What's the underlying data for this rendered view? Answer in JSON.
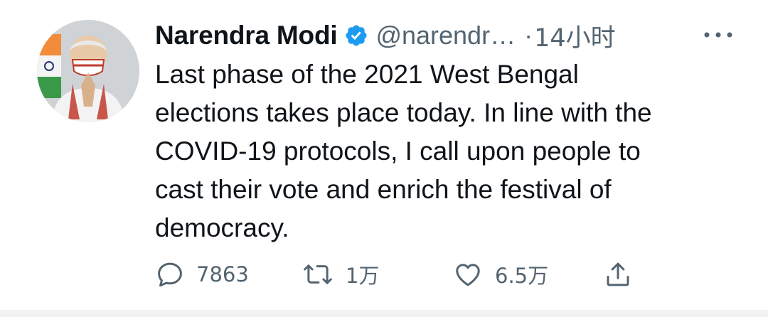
{
  "tweet": {
    "author": {
      "display_name": "Narendra Modi",
      "handle": "@narendr…",
      "avatar_icon": "avatar-photo",
      "verified_icon": "verified-badge-icon"
    },
    "separator": "·",
    "time": "14小时",
    "more_icon": "more-icon",
    "text_lines": [
      "Last phase of the 2021 West Bengal",
      "elections takes place today. In line with the",
      "COVID-19 protocols, I call upon people to",
      "cast their vote and enrich the festival of",
      "democracy."
    ],
    "actions": {
      "reply": {
        "icon": "reply-icon",
        "count": "7863"
      },
      "retweet": {
        "icon": "retweet-icon",
        "count": "1万"
      },
      "like": {
        "icon": "heart-icon",
        "count": "6.5万"
      },
      "share": {
        "icon": "share-icon"
      }
    }
  },
  "colors": {
    "text_primary": "#0f1419",
    "text_secondary": "#536471",
    "verified_blue": "#1d9bf0"
  }
}
